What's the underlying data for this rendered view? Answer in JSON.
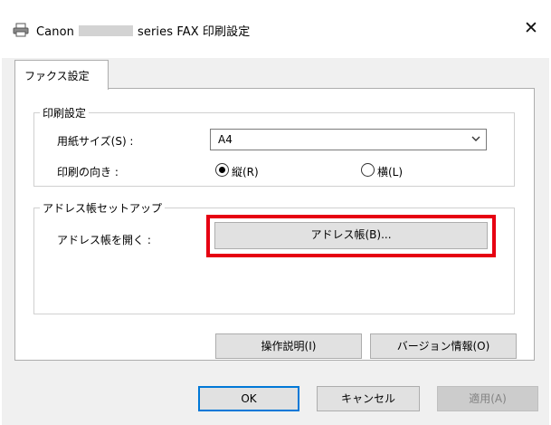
{
  "window": {
    "title_prefix": "Canon",
    "title_suffix": "series FAX 印刷設定",
    "close_symbol": "✕"
  },
  "tabs": [
    {
      "label": "ファクス設定",
      "active": true
    }
  ],
  "print_settings": {
    "legend": "印刷設定",
    "paper_size_label": "用紙サイズ(S) :",
    "paper_size_value": "A4",
    "orientation_label": "印刷の向き :",
    "portrait_label": "縦(R)",
    "landscape_label": "横(L)",
    "selected_orientation": "portrait"
  },
  "address_book": {
    "legend": "アドレス帳セットアップ",
    "open_label": "アドレス帳を開く :",
    "button_label": "アドレス帳(B)..."
  },
  "buttons": {
    "manual": "操作説明(I)",
    "version": "バージョン情報(O)",
    "ok": "OK",
    "cancel": "キャンセル",
    "apply": "適用(A)"
  },
  "colors": {
    "highlight": "#e60012",
    "default_button_border": "#0078d7"
  },
  "icons": {
    "title": "printer-icon",
    "close": "close-icon",
    "dropdown": "chevron-down-icon"
  }
}
